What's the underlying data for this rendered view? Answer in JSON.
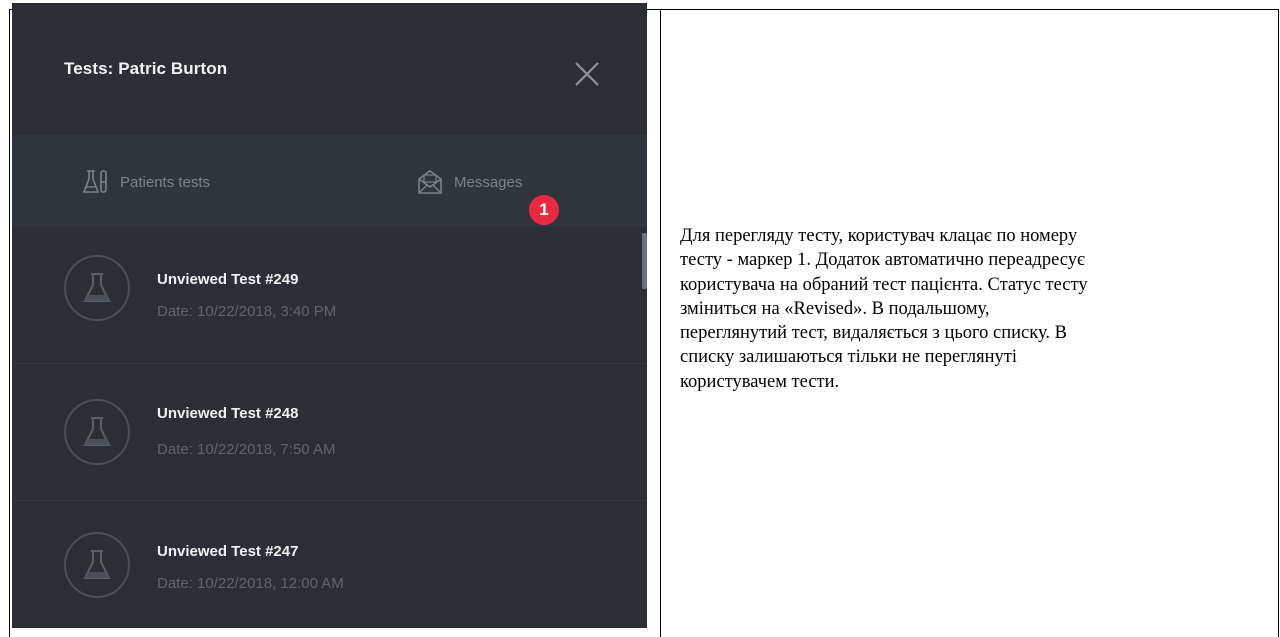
{
  "panel": {
    "title": "Tests: Patric Burton",
    "close_icon": "close-icon",
    "tabs": [
      {
        "label": "Patients tests",
        "icon": "lab-flasks-icon"
      },
      {
        "label": "Messages",
        "icon": "envelope-icon"
      }
    ],
    "tests": [
      {
        "title": "Unviewed Test #249",
        "date": "Date: 10/22/2018, 3:40 PM",
        "icon": "flask-icon"
      },
      {
        "title": "Unviewed Test #248",
        "date": "Date: 10/22/2018, 7:50 AM",
        "icon": "flask-icon"
      },
      {
        "title": "Unviewed Test #247",
        "date": "Date: 10/22/2018, 12:00 AM",
        "icon": "flask-icon"
      }
    ],
    "marker": "1",
    "colors": {
      "panel_bg": "#2b2f35",
      "marker": "#e8293f"
    }
  },
  "description": {
    "lines": [
      "Для перегляду тесту, користувач клацає по номеру",
      "тесту - маркер 1. Додаток автоматично переадресує",
      "користувача на обраний тест пацієнта. Статус тесту",
      "зміниться на «Revised». В подальшому,",
      "переглянутий тест, видаляється з цього списку. В",
      "списку залишаються тільки не переглянуті",
      "користувачем тести."
    ]
  }
}
